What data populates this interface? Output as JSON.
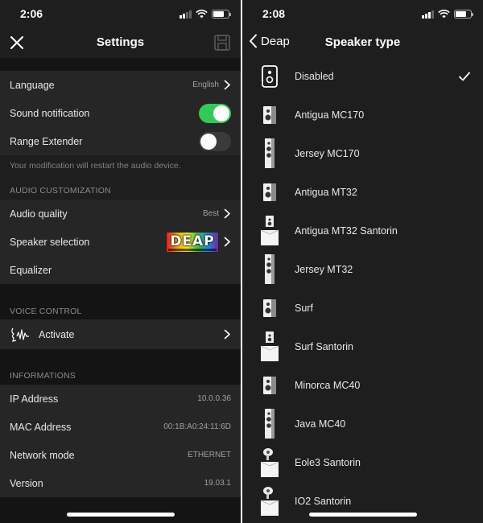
{
  "left": {
    "status": {
      "time": "2:06"
    },
    "nav": {
      "title": "Settings"
    },
    "general": [
      {
        "label": "Language",
        "value": "English"
      },
      {
        "label": "Sound notification",
        "toggle": true
      },
      {
        "label": "Range Extender",
        "toggle": false
      }
    ],
    "hint": "Your modification will restart the audio device.",
    "audio_header": "AUDIO CUSTOMIZATION",
    "audio": [
      {
        "label": "Audio quality",
        "value": "Best"
      },
      {
        "label": "Speaker selection",
        "logo_text": "DEAP"
      },
      {
        "label": "Equalizer"
      }
    ],
    "voice_header": "VOICE CONTROL",
    "voice": {
      "label": "Activate"
    },
    "info_header": "INFORMATIONS",
    "info": [
      {
        "label": "IP Address",
        "value": "10.0.0.36"
      },
      {
        "label": "MAC Address",
        "value": "00:1B:A0:24:11:6D"
      },
      {
        "label": "Network mode",
        "value": "ETHERNET"
      },
      {
        "label": "Version",
        "value": "19.03.1"
      }
    ]
  },
  "right": {
    "status": {
      "time": "2:08"
    },
    "nav": {
      "back_label": "Deap",
      "title": "Speaker type"
    },
    "speakers": [
      {
        "name": "Disabled",
        "icon": "disabled-speaker-icon",
        "selected": true
      },
      {
        "name": "Antigua MC170",
        "icon": "bookshelf-speaker-icon"
      },
      {
        "name": "Jersey MC170",
        "icon": "floorstanding-speaker-icon"
      },
      {
        "name": "Antigua MT32",
        "icon": "bookshelf-speaker-icon"
      },
      {
        "name": "Antigua MT32 Santorin",
        "icon": "speaker-on-stand-icon"
      },
      {
        "name": "Jersey MT32",
        "icon": "floorstanding-speaker-icon"
      },
      {
        "name": "Surf",
        "icon": "bookshelf-speaker-icon"
      },
      {
        "name": "Surf Santorin",
        "icon": "speaker-on-stand-icon"
      },
      {
        "name": "Minorca MC40",
        "icon": "bookshelf-speaker-icon"
      },
      {
        "name": "Java MC40",
        "icon": "floorstanding-speaker-icon"
      },
      {
        "name": "Eole3 Santorin",
        "icon": "satellite-on-stand-icon"
      },
      {
        "name": "IO2 Santorin",
        "icon": "satellite-on-stand-icon"
      }
    ]
  },
  "colors": {
    "background": "#1e1e1e",
    "row": "#262626",
    "toggle_on": "#34c759",
    "section_text": "#8b8b8b"
  }
}
